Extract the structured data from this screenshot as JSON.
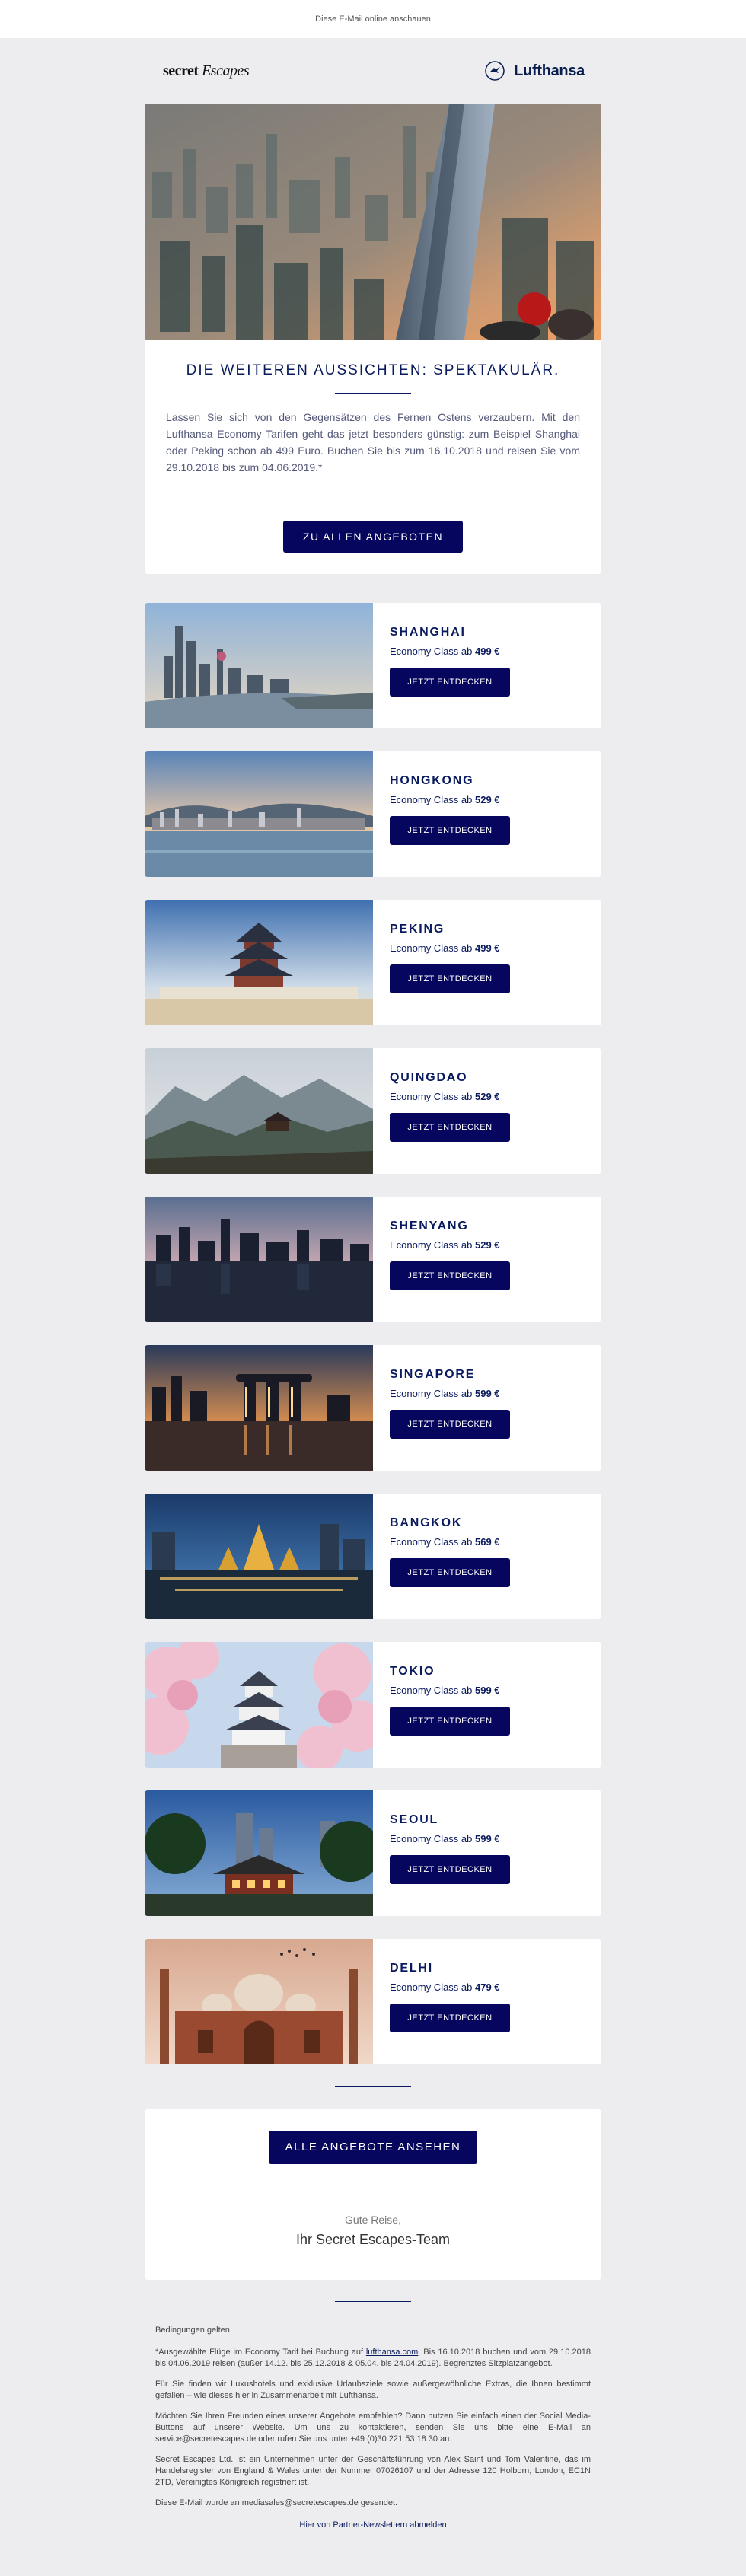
{
  "topbar": {
    "view_online": "Diese E-Mail online anschauen"
  },
  "logos": {
    "secret_escapes_part1": "secret ",
    "secret_escapes_part2": "Escapes",
    "lufthansa": "Lufthansa"
  },
  "hero": {
    "title": "DIE WEITEREN AUSSICHTEN: SPEKTAKULÄR.",
    "body": "Lassen Sie sich von den Gegensätzen des Fernen Ostens verzaubern. Mit den Lufthansa Economy Tarifen geht das jetzt besonders günstig: zum Beispiel Shanghai oder Peking schon ab 499 Euro. Buchen Sie bis zum 16.10.2018 und reisen Sie vom 29.10.2018 bis zum 04.06.2019.*",
    "button": "ZU ALLEN ANGEBOTEN"
  },
  "destinations": [
    {
      "name": "SHANGHAI",
      "price_prefix": "Economy Class ab ",
      "price": "499 €",
      "button": "JETZT ENTDECKEN"
    },
    {
      "name": "HONGKONG",
      "price_prefix": "Economy Class ab ",
      "price": "529 €",
      "button": "JETZT ENTDECKEN"
    },
    {
      "name": "PEKING",
      "price_prefix": "Economy Class ab ",
      "price": "499 €",
      "button": "JETZT ENTDECKEN"
    },
    {
      "name": "QUINGDAO",
      "price_prefix": "Economy Class ab ",
      "price": "529 €",
      "button": "JETZT ENTDECKEN"
    },
    {
      "name": "SHENYANG",
      "price_prefix": "Economy Class ab ",
      "price": "529 €",
      "button": "JETZT ENTDECKEN"
    },
    {
      "name": "SINGAPORE",
      "price_prefix": "Economy Class ab ",
      "price": "599 €",
      "button": "JETZT ENTDECKEN"
    },
    {
      "name": "BANGKOK",
      "price_prefix": "Economy Class ab ",
      "price": "569 €",
      "button": "JETZT ENTDECKEN"
    },
    {
      "name": "TOKIO",
      "price_prefix": "Economy Class ab ",
      "price": "599 €",
      "button": "JETZT ENTDECKEN"
    },
    {
      "name": "SEOUL",
      "price_prefix": "Economy Class ab ",
      "price": "599 €",
      "button": "JETZT ENTDECKEN"
    },
    {
      "name": "DELHI",
      "price_prefix": "Economy Class ab ",
      "price": "479 €",
      "button": "JETZT ENTDECKEN"
    }
  ],
  "cta": {
    "button": "ALLE ANGEBOTE ANSEHEN",
    "greeting": "Gute Reise,",
    "signature": "Ihr Secret Escapes-Team"
  },
  "footer": {
    "conditions_title": "Bedingungen gelten",
    "p1_a": "*Ausgewählte Flüge im Economy Tarif bei Buchung auf ",
    "p1_link": "lufthansa.com",
    "p1_b": ". Bis 16.10.2018 buchen und vom 29.10.2018 bis 04.06.2019 reisen (außer 14.12. bis 25.12.2018 & 05.04. bis 24.04.2019). Begrenztes Sitzplatzangebot.",
    "p2": "Für Sie finden wir Luxushotels und exklusive Urlaubsziele sowie außergewöhnliche Extras, die Ihnen bestimmt gefallen – wie dieses hier in Zusammenarbeit mit Lufthansa.",
    "p3": "Möchten Sie Ihren Freunden eines unserer Angebote empfehlen? Dann nutzen Sie einfach einen der Social Media-Buttons auf unserer Website. Um uns zu kontaktieren, senden Sie uns bitte eine E-Mail an service@secretescapes.de oder rufen Sie uns unter +49 (0)30 221 53 18 30 an.",
    "p4": "Secret Escapes Ltd. ist ein Unternehmen unter der Geschäftsführung von Alex Saint und Tom Valentine, das im Handelsregister von England & Wales unter der Nummer 07026107 und der Adresse 120 Holborn, London, EC1N 2TD, Vereinigtes Königreich registriert ist.",
    "p5": "Diese E-Mail wurde an mediasales@secretescapes.de gesendet.",
    "unsubscribe": "Hier von Partner-Newslettern abmelden"
  },
  "colors": {
    "navy": "#06065e",
    "background": "#ededef",
    "title": "#0a1a5e"
  }
}
